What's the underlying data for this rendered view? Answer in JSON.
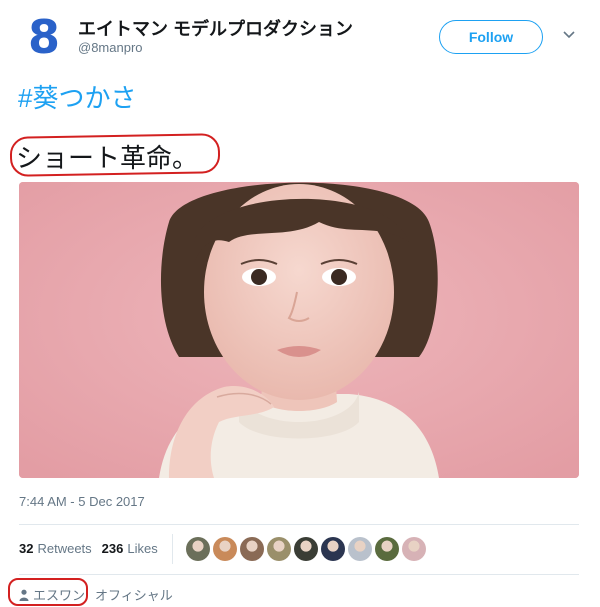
{
  "header": {
    "avatar_glyph": "8",
    "display_name": "エイトマン モデルプロダクション",
    "handle": "@8manpro",
    "follow_label": "Follow",
    "more_icon": "chevron-down-icon"
  },
  "tweet": {
    "hashtag": "#葵つかさ",
    "text": "ショート革命。",
    "timestamp": "7:44 AM - 5 Dec 2017"
  },
  "stats": {
    "retweets_count": "32",
    "retweets_label": "Retweets",
    "likes_count": "236",
    "likes_label": "Likes",
    "liker_avatars": [
      "#6b6f5a",
      "#c98a5a",
      "#8a6a55",
      "#9a8f6a",
      "#3a3d35",
      "#2b3550",
      "#b9c1cc",
      "#5a6b3e",
      "#d7b2b6"
    ]
  },
  "footer": {
    "person_icon": "person-icon",
    "tag_user": "エスワン",
    "tag_user_2": "オフィシャル"
  },
  "colors": {
    "accent": "#1da1f2",
    "highlight": "#d32020",
    "media_background": "#e9a7ad"
  }
}
